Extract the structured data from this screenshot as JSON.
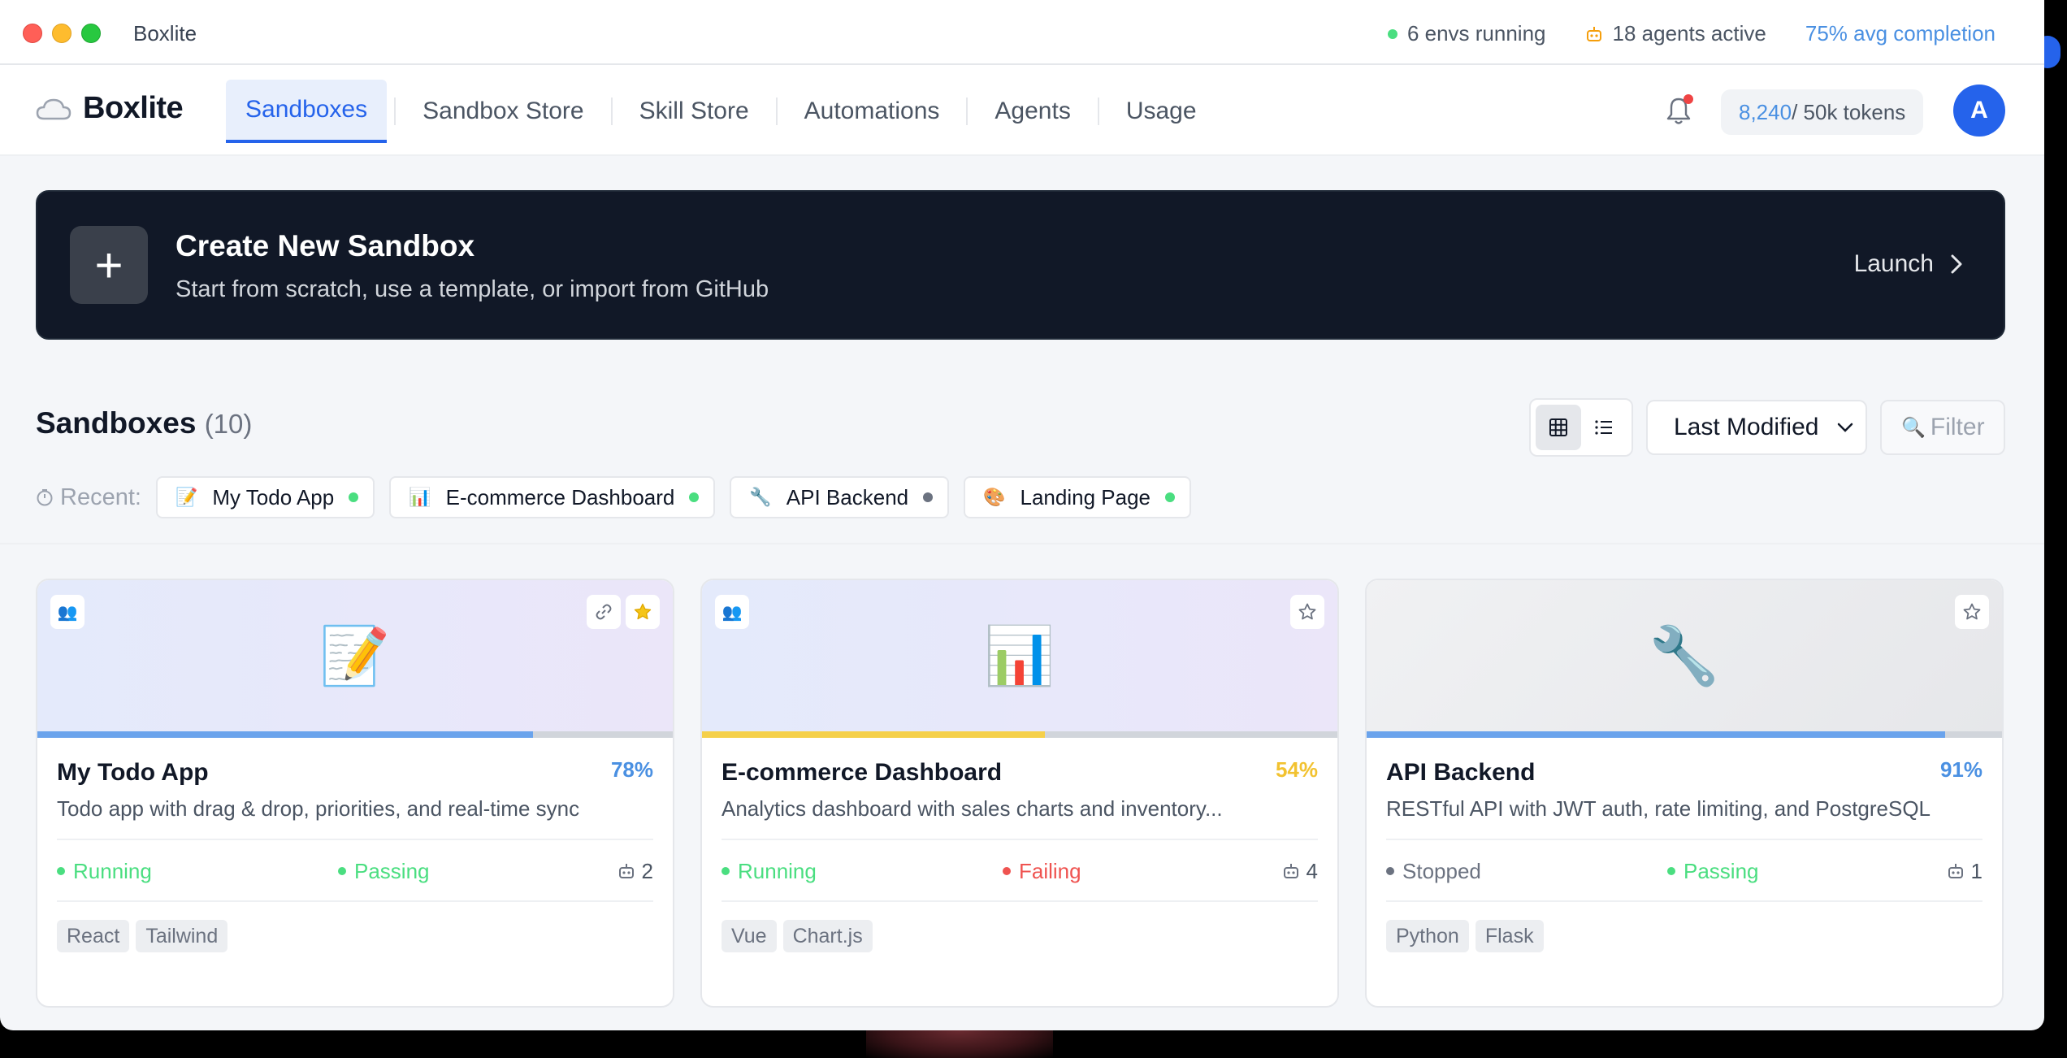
{
  "titlebar": {
    "app_name": "Boxlite",
    "stats": {
      "envs_running": "6 envs running",
      "agents_active": "18 agents active",
      "avg_completion": "75% avg completion"
    }
  },
  "nav": {
    "logo_text": "Boxlite",
    "tabs": [
      {
        "label": "Sandboxes",
        "active": true
      },
      {
        "label": "Sandbox Store",
        "active": false
      },
      {
        "label": "Skill Store",
        "active": false
      },
      {
        "label": "Automations",
        "active": false
      },
      {
        "label": "Agents",
        "active": false
      },
      {
        "label": "Usage",
        "active": false
      }
    ],
    "tokens_used": "8,240",
    "tokens_total": " / 50k tokens",
    "avatar_initial": "A"
  },
  "banner": {
    "title": "Create New Sandbox",
    "subtitle": "Start from scratch, use a template, or import from GitHub",
    "plus": "+",
    "launch_label": "Launch"
  },
  "sandboxes": {
    "heading": "Sandboxes",
    "count": "(10)",
    "sort_value": "Last Modified",
    "filter_placeholder": "Filter",
    "recent_label": "Recent:",
    "recent": [
      {
        "emoji": "📝",
        "name": "My Todo App",
        "status_color": "#4ade80"
      },
      {
        "emoji": "📊",
        "name": "E-commerce Dashboard",
        "status_color": "#4ade80"
      },
      {
        "emoji": "🔧",
        "name": "API Backend",
        "status_color": "#6b7280"
      },
      {
        "emoji": "🎨",
        "name": "Landing Page",
        "status_color": "#4ade80"
      }
    ]
  },
  "cards": [
    {
      "emoji": "📝",
      "title": "My Todo App",
      "percent": "78%",
      "progress": 0.78,
      "progress_color": "#6aa3ec",
      "percent_color": "#4a90e2",
      "description": "Todo app with drag & drop, priorities, and real-time sync",
      "run_status": "Running",
      "run_color": "#4ade80",
      "test_status": "Passing",
      "test_color": "#4ade80",
      "agents": "2",
      "tags": [
        "React",
        "Tailwind"
      ],
      "shared": true,
      "link": true,
      "starred": true
    },
    {
      "emoji": "📊",
      "title": "E-commerce Dashboard",
      "percent": "54%",
      "progress": 0.54,
      "progress_color": "#f5d04a",
      "percent_color": "#f2c230",
      "description": "Analytics dashboard with sales charts and inventory...",
      "run_status": "Running",
      "run_color": "#4ade80",
      "test_status": "Failing",
      "test_color": "#ef5350",
      "agents": "4",
      "tags": [
        "Vue",
        "Chart.js"
      ],
      "shared": true,
      "link": false,
      "starred": false
    },
    {
      "emoji": "🔧",
      "title": "API Backend",
      "percent": "91%",
      "progress": 0.91,
      "progress_color": "#6aa3ec",
      "percent_color": "#4a90e2",
      "description": "RESTful API with JWT auth, rate limiting, and PostgreSQL",
      "run_status": "Stopped",
      "run_color": "#6b7280",
      "test_status": "Passing",
      "test_color": "#4ade80",
      "agents": "1",
      "tags": [
        "Python",
        "Flask"
      ],
      "shared": false,
      "link": false,
      "starred": false
    }
  ]
}
